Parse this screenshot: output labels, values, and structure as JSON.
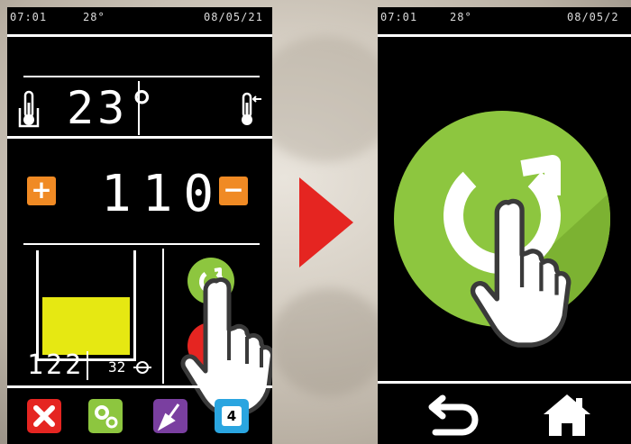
{
  "left_panel": {
    "status": {
      "time": "07:01",
      "temperature": "28°",
      "date": "08/05/21"
    },
    "temperature_display": "23°",
    "count_display": "110",
    "plus_label": "+",
    "minus_label": "−",
    "level_value": "122",
    "level_unit": "32",
    "level_fraction": 0.55,
    "app_badge": "4"
  },
  "right_panel": {
    "status": {
      "time": "07:01",
      "temperature": "28°",
      "date": "08/05/2"
    }
  },
  "colors": {
    "accent_orange": "#f08a24",
    "refresh_green": "#8dc63f",
    "arrow_red": "#e52521",
    "tank_yellow": "#e6e812",
    "tool_red": "#e52521",
    "settings_green": "#8dc63f",
    "clean_purple": "#7a3fa0",
    "badge_blue": "#2aa5e0"
  }
}
